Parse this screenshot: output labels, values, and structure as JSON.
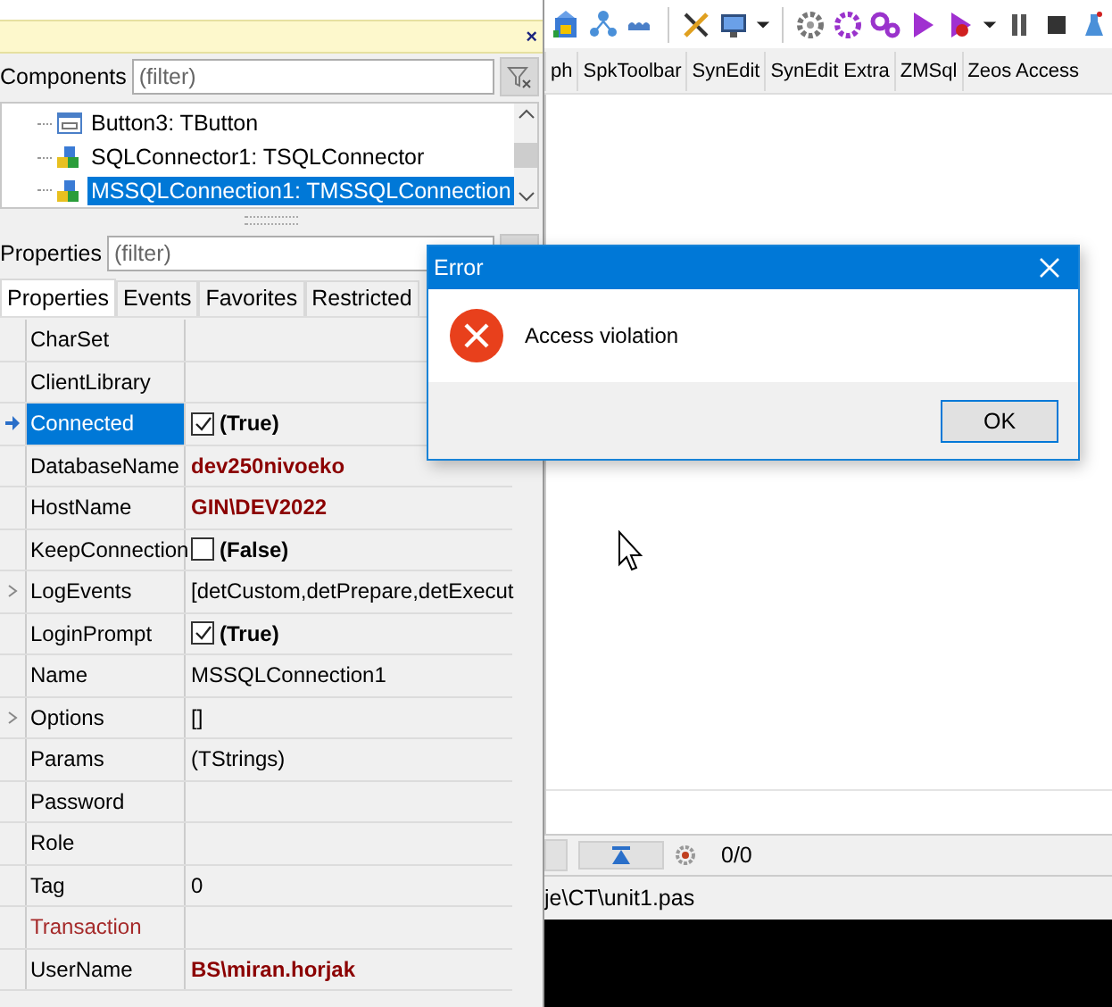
{
  "object_inspector": {
    "hint_close": "×",
    "components_label": "Components",
    "components_filter": {
      "placeholder": "(filter)"
    },
    "tree": [
      {
        "label": "Button3: TButton",
        "kind": "button",
        "selected": false
      },
      {
        "label": "SQLConnector1: TSQLConnector",
        "kind": "connection",
        "selected": false
      },
      {
        "label": "MSSQLConnection1: TMSSQLConnection",
        "kind": "connection",
        "selected": true
      }
    ],
    "properties_label": "Properties",
    "properties_filter": {
      "placeholder": "(filter)"
    },
    "tabs": [
      {
        "label": "Properties",
        "selected": true
      },
      {
        "label": "Events",
        "selected": false
      },
      {
        "label": "Favorites",
        "selected": false
      },
      {
        "label": "Restricted",
        "selected": false
      }
    ],
    "properties": [
      {
        "name": "CharSet",
        "kind": "text",
        "reference": false,
        "expandable": false,
        "selected": false
      },
      {
        "name": "ClientLibrary",
        "kind": "text",
        "reference": false,
        "expandable": false,
        "selected": false
      },
      {
        "name": "Connected",
        "kind": "checkbox",
        "checked": true,
        "value": "(True)",
        "reference": false,
        "expandable": false,
        "selected": true
      },
      {
        "name": "DatabaseName",
        "kind": "text",
        "value": "dev250nivoeko",
        "modified": true,
        "reference": false,
        "expandable": false,
        "selected": false
      },
      {
        "name": "HostName",
        "kind": "text",
        "value": "GIN\\DEV2022",
        "modified": true,
        "reference": false,
        "expandable": false,
        "selected": false
      },
      {
        "name": "KeepConnection",
        "kind": "checkbox",
        "checked": false,
        "value": "(False)",
        "reference": false,
        "expandable": false,
        "selected": false
      },
      {
        "name": "LogEvents",
        "kind": "text",
        "value": "[detCustom,detPrepare,detExecut",
        "modified": false,
        "reference": false,
        "expandable": true,
        "selected": false
      },
      {
        "name": "LoginPrompt",
        "kind": "checkbox",
        "checked": true,
        "value": "(True)",
        "reference": false,
        "expandable": false,
        "selected": false
      },
      {
        "name": "Name",
        "kind": "text",
        "value": "MSSQLConnection1",
        "modified": false,
        "reference": false,
        "expandable": false,
        "selected": false
      },
      {
        "name": "Options",
        "kind": "text",
        "value": "[]",
        "modified": false,
        "reference": false,
        "expandable": true,
        "selected": false
      },
      {
        "name": "Params",
        "kind": "text",
        "value": "(TStrings)",
        "modified": false,
        "reference": false,
        "expandable": false,
        "selected": false
      },
      {
        "name": "Password",
        "kind": "text",
        "reference": false,
        "expandable": false,
        "selected": false
      },
      {
        "name": "Role",
        "kind": "text",
        "reference": false,
        "expandable": false,
        "selected": false
      },
      {
        "name": "Tag",
        "kind": "text",
        "value": "0",
        "modified": false,
        "reference": false,
        "expandable": false,
        "selected": false
      },
      {
        "name": "Transaction",
        "kind": "text",
        "reference": true,
        "expandable": false,
        "selected": false
      },
      {
        "name": "UserName",
        "kind": "text",
        "value": "BS\\miran.horjak",
        "modified": true,
        "reference": false,
        "expandable": false,
        "selected": false
      }
    ]
  },
  "ide": {
    "palette_tabs": [
      "ph",
      "SpkToolbar",
      "SynEdit",
      "SynEdit Extra",
      "ZMSql",
      "Zeos Access"
    ],
    "position": "0/0",
    "file_path": "je\\CT\\unit1.pas"
  },
  "dialog": {
    "title": "Error",
    "message": "Access violation",
    "buttons": [
      "OK"
    ]
  }
}
